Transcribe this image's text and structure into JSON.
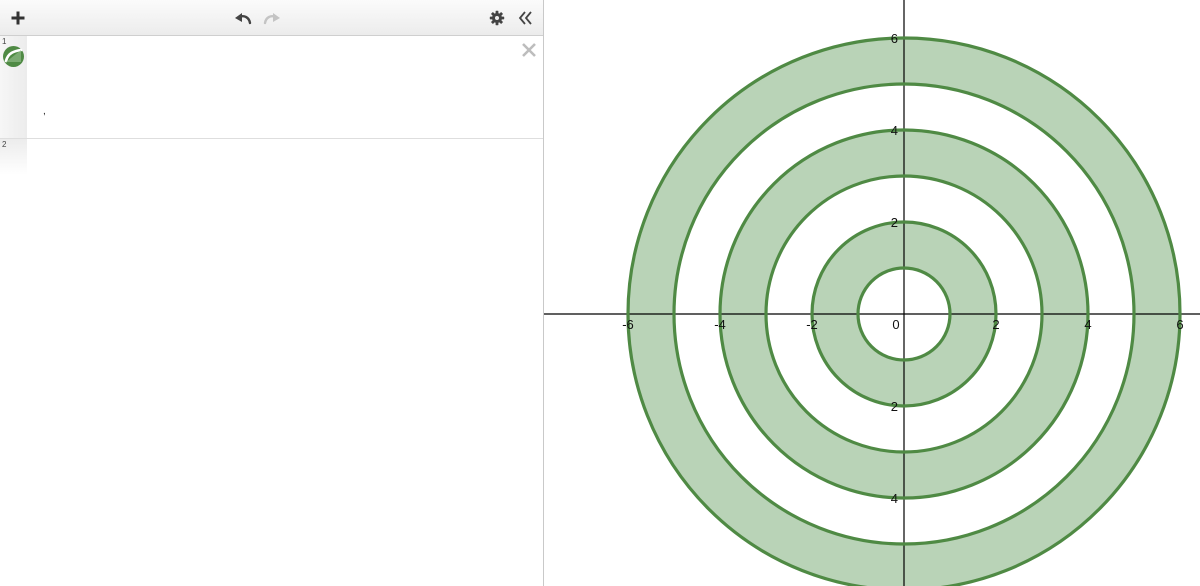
{
  "toolbar": {
    "add_icon": "plus-icon",
    "undo_icon": "undo-icon",
    "redo_icon": "redo-icon",
    "settings_icon": "gear-icon",
    "collapse_icon": "double-chevron-left-icon"
  },
  "expressions": [
    {
      "index": "1",
      "color": "#4f8a44",
      "icon": "graphed-expression-icon",
      "content": ",",
      "delete_icon": "close-icon"
    },
    {
      "index": "2",
      "content": ""
    }
  ],
  "graph": {
    "x_tick_labels": [
      "-6",
      "-4",
      "-2",
      "0",
      "2",
      "4",
      "6"
    ],
    "y_tick_labels": [
      "6",
      "4",
      "2",
      "2",
      "4",
      "6"
    ],
    "stroke_color": "#4f8a44",
    "fill_color": "#b9d3b7",
    "rings": [
      {
        "inner_radius": 1,
        "outer_radius": 2
      },
      {
        "inner_radius": 3,
        "outer_radius": 4
      },
      {
        "inner_radius": 5,
        "outer_radius": 6
      }
    ]
  }
}
